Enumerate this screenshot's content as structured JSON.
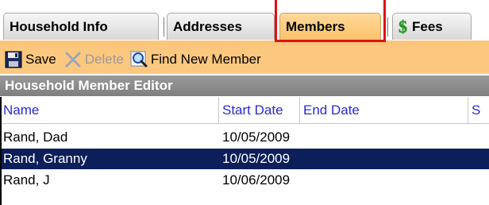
{
  "tabs": [
    {
      "label": "Household Info",
      "active": false
    },
    {
      "label": "Addresses",
      "active": false
    },
    {
      "label": "Members",
      "active": true
    },
    {
      "label": "Fees",
      "active": false,
      "icon": "dollar-icon"
    }
  ],
  "toolbar": {
    "save_label": "Save",
    "delete_label": "Delete",
    "find_label": "Find New Member"
  },
  "editor": {
    "title": "Household Member Editor",
    "columns": [
      "Name",
      "Start Date",
      "End Date",
      "S"
    ],
    "rows": [
      {
        "name": "Rand, Dad",
        "start": "10/05/2009",
        "end": "",
        "selected": false
      },
      {
        "name": "Rand, Granny",
        "start": "10/05/2009",
        "end": "",
        "selected": true
      },
      {
        "name": "Rand, J",
        "start": "10/06/2009",
        "end": "",
        "selected": false
      }
    ]
  },
  "colors": {
    "accent": "#fcc880",
    "selected_row": "#0d1f5a",
    "header_text": "#2a2ad0",
    "highlight": "#e01010"
  }
}
